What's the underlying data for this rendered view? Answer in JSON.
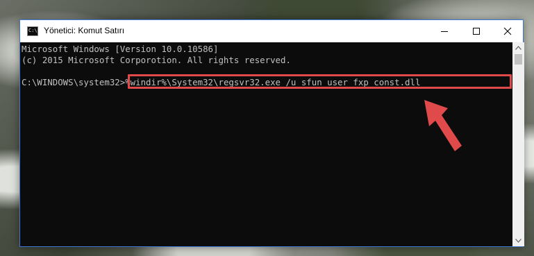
{
  "window": {
    "title": "Yönetici: Komut Satırı",
    "icon": "cmd-icon",
    "icon_glyph": "C:\\",
    "controls": {
      "minimize": "minimize-icon",
      "maximize": "maximize-icon",
      "close": "close-icon"
    }
  },
  "console": {
    "lines": [
      "Microsoft Windows [Version 10.0.10586]",
      "(c) 2015 Microsoft Corporotion. All rights reserved.",
      "",
      "C:\\WINDOWS\\system32>%windir%\\System32\\regsvr32.exe /u sfun_user_fxp_const.dll"
    ],
    "prompt": "C:\\WINDOWS\\system32>",
    "command": "%windir%\\System32\\regsvr32.exe /u sfun_user_fxp_const.dll"
  },
  "annotation": {
    "highlight_color": "#e04a4a",
    "arrow": "arrow-icon"
  },
  "colors": {
    "console_bg": "#0c0c0c",
    "console_text": "#c0c0c0",
    "window_border": "#3d7ad6"
  }
}
